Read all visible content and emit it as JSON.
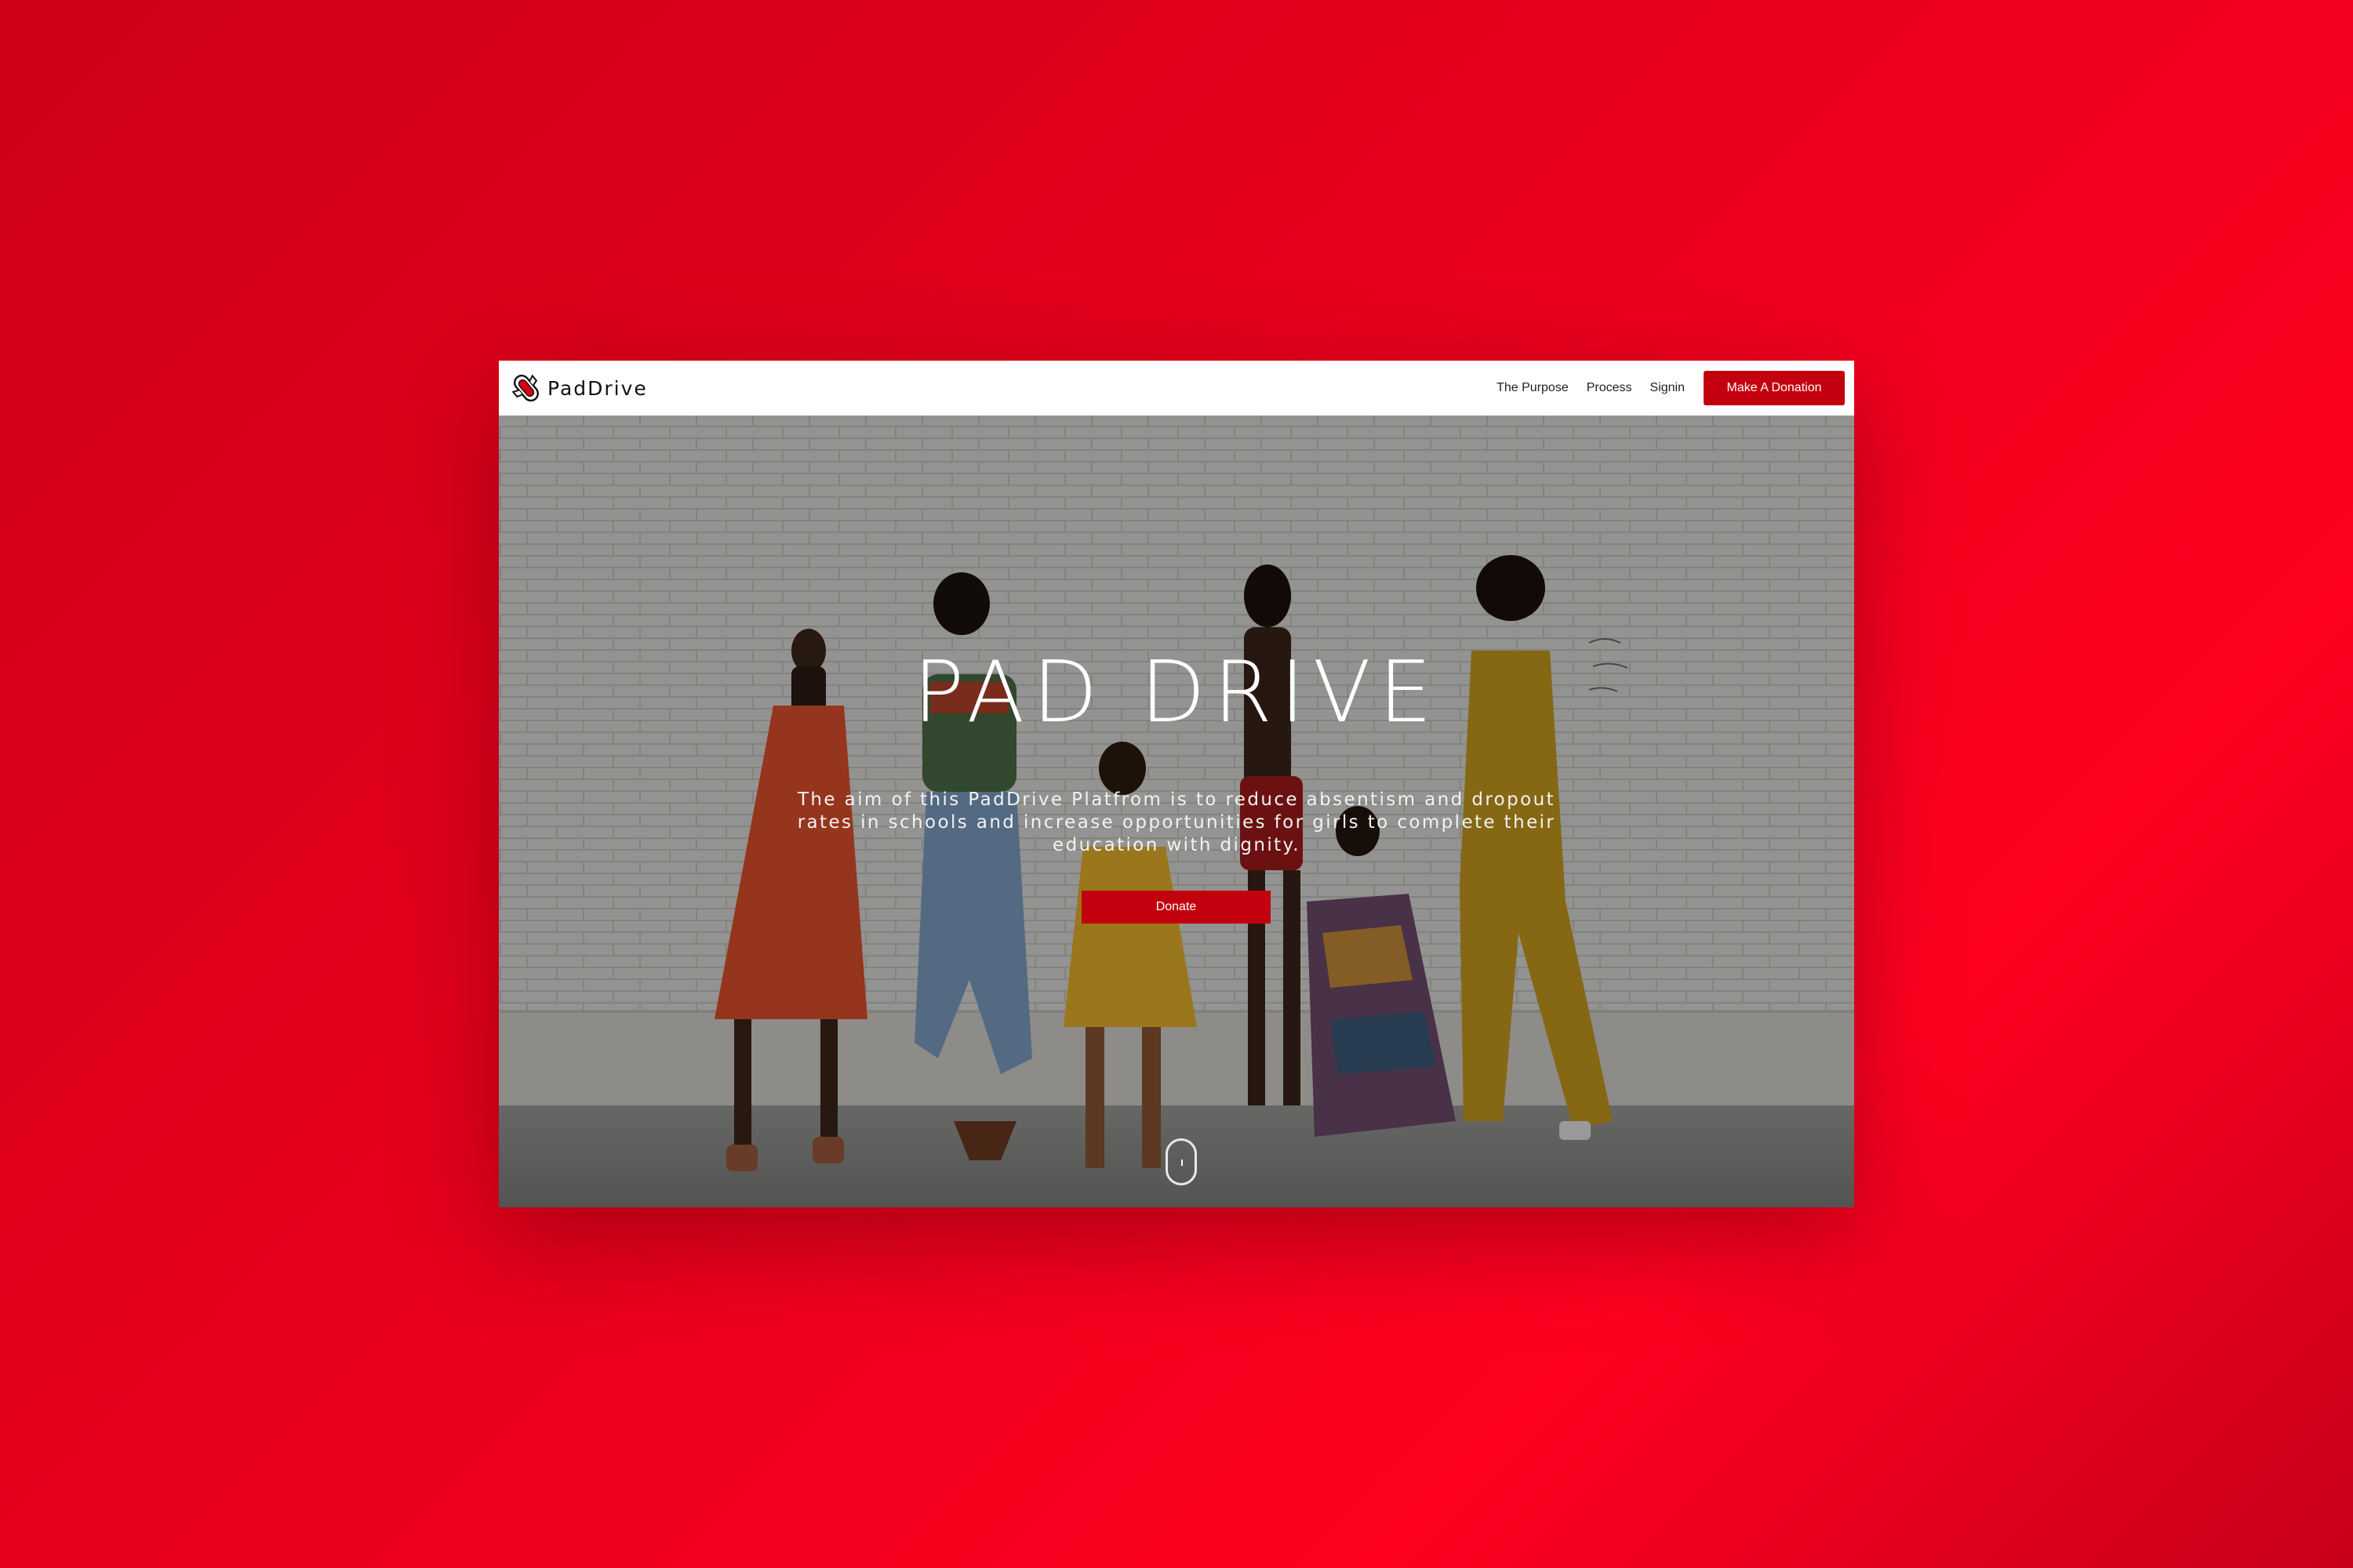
{
  "brand": {
    "name": "PadDrive",
    "logo_icon": "pad-logo-icon"
  },
  "nav": {
    "links": [
      "The Purpose",
      "Process",
      "Signin"
    ],
    "cta_label": "Make A Donation"
  },
  "hero": {
    "title": "PAD DRIVE",
    "subtitle": "The aim of this PadDrive Platfrom is to reduce absentism and dropout rates in schools and increase opportunities for girls to complete their education with dignity.",
    "button_label": "Donate",
    "scroll_icon": "mouse-scroll-icon"
  },
  "colors": {
    "background_red": "#e8001c",
    "accent_red": "#c3000d",
    "navbar_bg": "#ffffff",
    "text_white": "#ffffff"
  }
}
